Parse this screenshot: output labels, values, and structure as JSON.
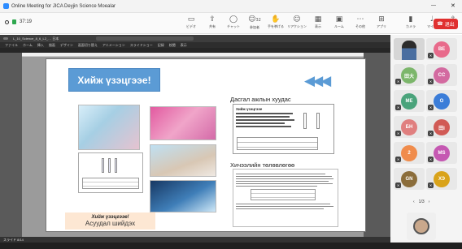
{
  "window": {
    "title": "Online Meeting for JICA Deyjin Science Moealar",
    "time": "37:19"
  },
  "toolbar": {
    "items": [
      {
        "icon": "camera-icon",
        "label": "ビデオ"
      },
      {
        "icon": "share-icon",
        "label": "共有"
      },
      {
        "icon": "chat-icon",
        "label": "チャット"
      },
      {
        "icon": "people-icon",
        "label": "参加者",
        "count": "32"
      },
      {
        "icon": "hand-icon",
        "label": "手を挙げる"
      },
      {
        "icon": "emoji-icon",
        "label": "リアクション"
      },
      {
        "icon": "grid-icon",
        "label": "表示"
      },
      {
        "icon": "rooms-icon",
        "label": "ルーム"
      },
      {
        "icon": "more-icon",
        "label": "その他"
      },
      {
        "icon": "apps-icon",
        "label": "アプリ"
      },
      {
        "icon": "camera-toggle-icon",
        "label": "カメラ"
      },
      {
        "icon": "mic-icon",
        "label": "マイク"
      },
      {
        "icon": "share-screen-icon",
        "label": "共有"
      }
    ],
    "leave_label": "退出"
  },
  "ppt": {
    "title_text": "L_10_Science_8_6_L2_… 日本",
    "tabs": [
      "ファイル",
      "ホーム",
      "挿入",
      "描画",
      "デザイン",
      "画面切り替え",
      "アニメーション",
      "スライドショー",
      "記録",
      "校閲",
      "表示"
    ],
    "status": "スライド 8/14"
  },
  "slide": {
    "banner": "Хийж үзэцгээе!",
    "arrows": "◀◀◀",
    "caption_line1": "Хийж үзэцгээе!",
    "caption_line2": "Асуудал шийдэх",
    "heading1": "Дасгал ажлын хуудас",
    "heading2": "Хичээлийн төлөвлөгөө",
    "doc1_title": "Хийж үзэцгээе"
  },
  "participants": [
    {
      "initials": "BE",
      "color": "#e86a8b"
    },
    {
      "initials": "田大",
      "color": "#7cb66b"
    },
    {
      "initials": "CC",
      "color": "#d36aa0"
    },
    {
      "initials": "ME",
      "color": "#4aa37b"
    },
    {
      "initials": "O",
      "color": "#3b7dd8"
    },
    {
      "initials": "БН",
      "color": "#e07f7f"
    },
    {
      "initials": "田I",
      "color": "#d15a55"
    },
    {
      "initials": "2",
      "color": "#f08c4c"
    },
    {
      "initials": "MS",
      "color": "#c558b2"
    },
    {
      "initials": "GN",
      "color": "#8b6d3b"
    },
    {
      "initials": "ХЭ",
      "color": "#d9a31a"
    }
  ],
  "pager": {
    "prev": "‹",
    "label": "1/3",
    "next": "›"
  }
}
